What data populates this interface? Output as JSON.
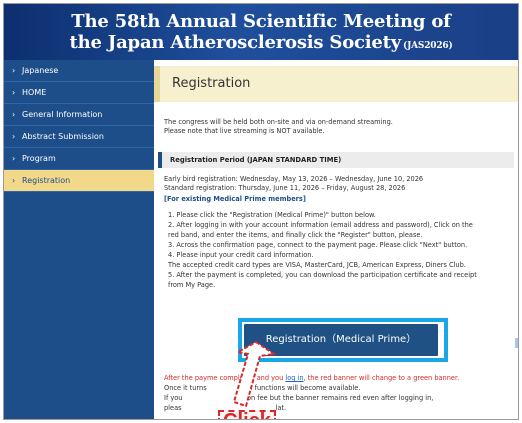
{
  "header": {
    "title_line1": "The 58th Annual Scientific Meeting of",
    "title_line2": "the Japan Atherosclerosis Society",
    "abbr": "(JAS2026)"
  },
  "sidebar": {
    "items": [
      {
        "label": "Japanese"
      },
      {
        "label": "HOME"
      },
      {
        "label": "General Information"
      },
      {
        "label": "Abstract Submission"
      },
      {
        "label": "Program"
      },
      {
        "label": "Registration"
      }
    ]
  },
  "main": {
    "page_title": "Registration",
    "intro_1": "The congress will be held both on-site and via on-demand streaming.",
    "intro_2": "Please note that live streaming is NOT available.",
    "period_heading": "Registration Period (JAPAN STANDARD TIME)",
    "early_bird": "Early bird registration: Wednesday, May 13, 2026 – Wednesday, June 10, 2026",
    "standard": "Standard registration: Thursday, June 11, 2026 – Friday, August 28, 2026",
    "existing_heading": "[For existing Medical Prime members]",
    "steps": [
      "1. Please click the \"Registration (Medical Prime)\" button below.",
      "2. After logging in with your account information (email address and password), Click on the",
      "    red band, and enter the items, and finally click the \"Register\" button, please.",
      "3. Across the confirmation page, connect to the payment page. Please click \"Next\" button.",
      "4. Please input your credit card information.",
      "    The accepted credit card types are VISA, MasterCard, JCB, American Express, Diners Club.",
      "5. After the payment is completed, you can download the participation certificate and receipt",
      "    from My Page."
    ],
    "button_label": "Registration（Medical Prime）",
    "after_1a": "After the payme",
    "after_1b": " completed and you ",
    "after_1_link": "log in",
    "after_1c": ", the red banner will change to a green banner.",
    "after_2a": "Once it turns",
    "after_2b": ", all functions will become available.",
    "after_3a": "If you",
    "after_3b": "ation fee but the banner remains red even after logging in,",
    "after_4a": "pleas",
    "after_4b": "lat."
  },
  "callout": {
    "label": "Click"
  },
  "colors": {
    "nav_bg": "#1d4e89",
    "nav_active": "#f2d98a",
    "button": "#1f5184",
    "highlight": "#1aa7e8",
    "callout": "#d62a2a"
  }
}
